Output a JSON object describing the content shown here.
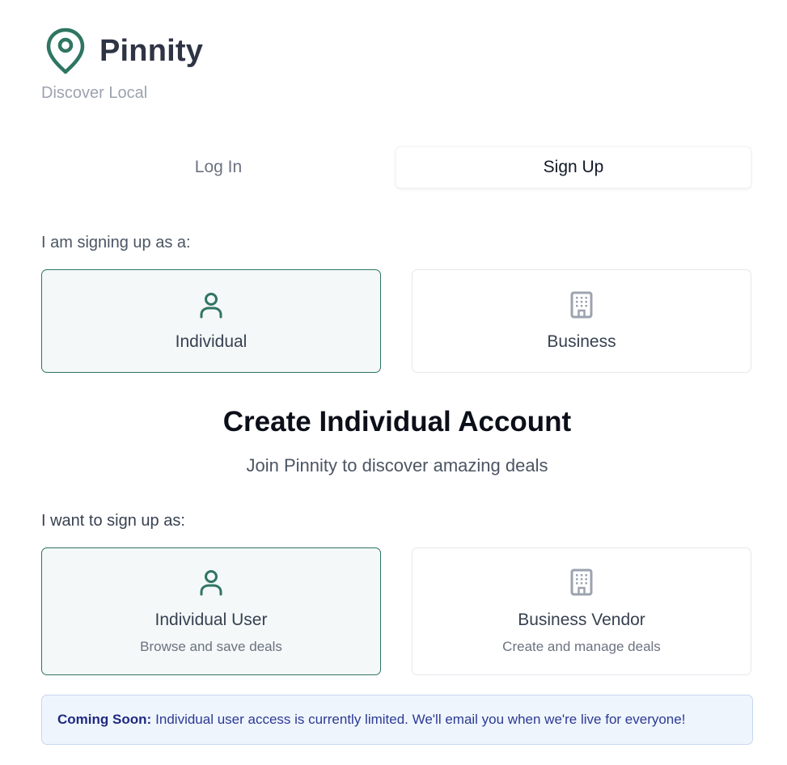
{
  "brand": {
    "name": "Pinnity",
    "tagline": "Discover Local",
    "accent_color": "#2f7562"
  },
  "tabs": [
    {
      "label": "Log In",
      "active": false
    },
    {
      "label": "Sign Up",
      "active": true
    }
  ],
  "account_type": {
    "label": "I am signing up as a:",
    "options": [
      {
        "label": "Individual",
        "icon": "user-icon",
        "selected": true
      },
      {
        "label": "Business",
        "icon": "building-icon",
        "selected": false
      }
    ]
  },
  "form": {
    "title": "Create Individual Account",
    "subtitle": "Join Pinnity to discover amazing deals"
  },
  "signup_role": {
    "label": "I want to sign up as:",
    "options": [
      {
        "label": "Individual User",
        "description": "Browse and save deals",
        "icon": "user-icon",
        "selected": true
      },
      {
        "label": "Business Vendor",
        "description": "Create and manage deals",
        "icon": "building-icon",
        "selected": false
      }
    ]
  },
  "notice": {
    "strong": "Coming Soon:",
    "text": "Individual user access is currently limited. We'll email you when we're live for everyone!"
  }
}
